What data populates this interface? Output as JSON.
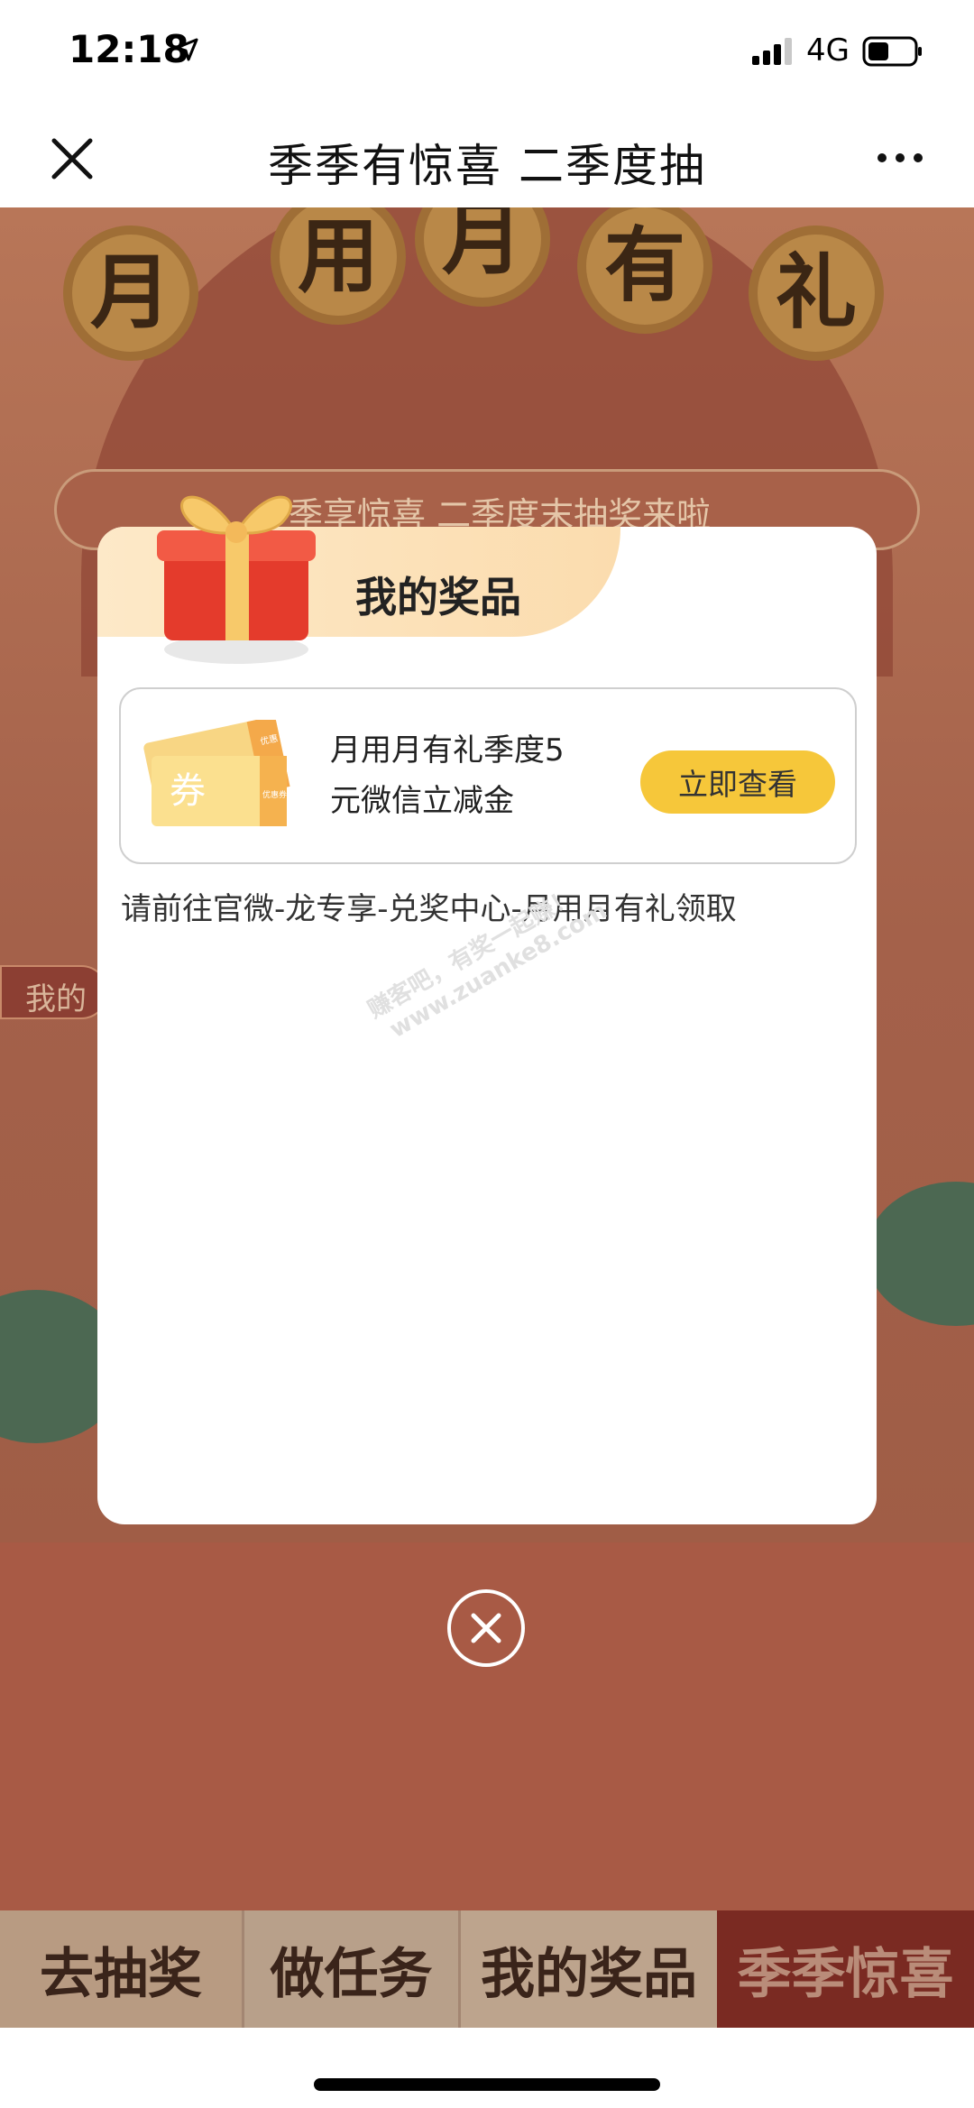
{
  "status_bar": {
    "time": "12:18",
    "network": "4G"
  },
  "nav": {
    "title": "季季有惊喜 二季度抽"
  },
  "background": {
    "coins": [
      "月",
      "用",
      "月",
      "有",
      "礼"
    ],
    "banner_text": "季享惊喜 二季度末抽奖来啦",
    "left_tag": "我的"
  },
  "modal": {
    "title": "我的奖品",
    "coupon_labels": {
      "main": "券",
      "side_top": "优惠",
      "side_bottom": "优惠券"
    },
    "prize": {
      "name_line1": "月用月有礼季度5",
      "name_line2": "元微信立减金",
      "button": "立即查看"
    },
    "hint": "请前往官微-龙专享-兑奖中心-月用月有礼领取",
    "watermark_line1": "赚客吧，有奖一起赚！",
    "watermark_line2": "www.zuanke8.com"
  },
  "tabs": [
    "去抽奖",
    "做任务",
    "我的奖品",
    "季季惊喜"
  ],
  "colors": {
    "accent_yellow": "#f6c73a",
    "header_band": "#fbdcae",
    "dim_background": "#a4614a"
  }
}
